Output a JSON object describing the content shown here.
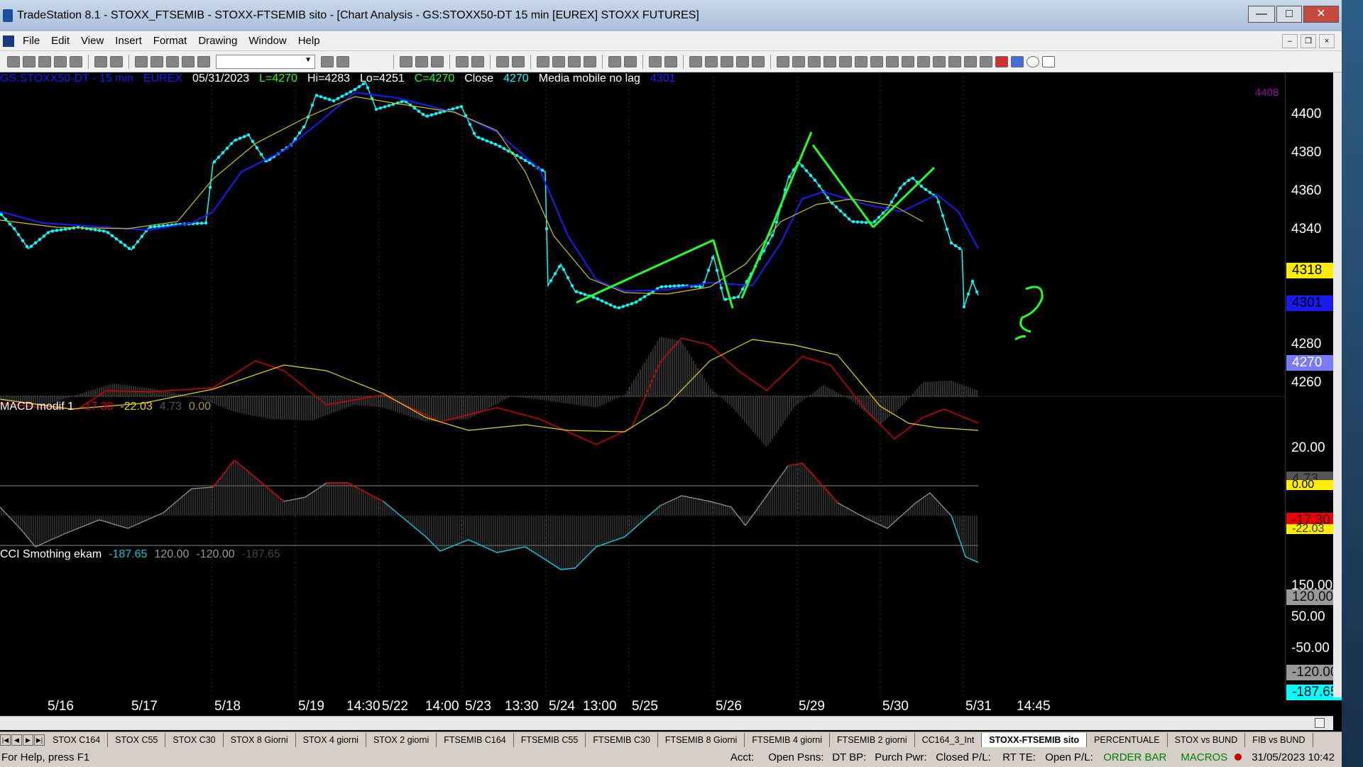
{
  "window": {
    "title": "TradeStation 8.1 - STOXX_FTSEMIB - STOXX-FTSEMIB sito - [Chart Analysis - GS:STOXX50-DT  15 min  [EUREX] STOXX FUTURES]"
  },
  "menu": [
    "File",
    "Edit",
    "View",
    "Insert",
    "Format",
    "Drawing",
    "Window",
    "Help"
  ],
  "chart_header": {
    "symbol": "GS:STOXX50-DT - 15 min",
    "exchange": "EUREX",
    "date": "05/31/2023",
    "low_last": "L=4270",
    "high": "Hi=4283",
    "low": "Lo=4251",
    "close": "C=4270",
    "close_label": "Close",
    "close_value": "4270",
    "indicator_name": "Media mobile no lag",
    "indicator_value": "4301",
    "topright_label": "4408"
  },
  "macd_header": {
    "name": "MACD modif 1",
    "v1": "-17.30",
    "v2": "-22.03",
    "v3": "4.73",
    "v4": "0.00"
  },
  "cci_header": {
    "name": "CCI Smothing ekam",
    "v1": "-187.65",
    "v2": "120.00",
    "v3": "-120.00",
    "v4": "-187.65"
  },
  "price_axis": {
    "ticks": [
      "4400",
      "4380",
      "4360",
      "4340",
      "4280",
      "4260"
    ],
    "labels": [
      "4318",
      "4301",
      "4270"
    ]
  },
  "macd_axis": {
    "ticks": [
      "20.00"
    ],
    "labels": [
      "4.73",
      "0.00",
      "-17.30",
      "-22.03"
    ]
  },
  "cci_axis": {
    "ticks": [
      "150.00",
      "50.00",
      "-50.00"
    ],
    "labels": [
      "120.00",
      "-120.00",
      "-187.65"
    ]
  },
  "x_axis": [
    "5/16",
    "5/17",
    "5/18",
    "5/19",
    "14:30",
    "5/22",
    "14:00",
    "5/23",
    "13:30",
    "5/24",
    "13:00",
    "5/25",
    "5/26",
    "5/29",
    "5/30",
    "5/31",
    "14:45"
  ],
  "tabs": [
    "STOX C164",
    "STOX C55",
    "STOX  C30",
    "STOX  8 Giorni",
    "STOX 4 giorni",
    "STOX  2 giorni",
    "FTSEMIB C164",
    "FTSEMIB C55",
    "FTSEMIB C30",
    "FTSEMIB  8 Giorni",
    "FTSEMIB  4 giorni",
    "FTSEMIB  2 giorni",
    "CC164_3_Int",
    "STOXX-FTSEMIB sito",
    "PERCENTUALE",
    "STOX vs BUND",
    "FIB vs BUND"
  ],
  "active_tab": "STOXX-FTSEMIB sito",
  "status": {
    "help": "For Help, press F1",
    "acct": "Acct:",
    "open_psns": "Open Psns:",
    "dt_bp": "DT BP:",
    "purch_pwr": "Purch Pwr:",
    "closed_pl": "Closed P/L:",
    "rt_te": "RT TE:",
    "open_pl": "Open P/L:",
    "order_bar": "ORDER BAR",
    "macros": "MACROS",
    "datetime": "31/05/2023 10:42"
  },
  "colors": {
    "price": "#00ffff",
    "nolag": "#1a1aff",
    "ma": "#d4c400",
    "trend": "#22ff22",
    "macd": "#e00000",
    "signal": "#e6d800",
    "cci": "#00c8e0"
  }
}
